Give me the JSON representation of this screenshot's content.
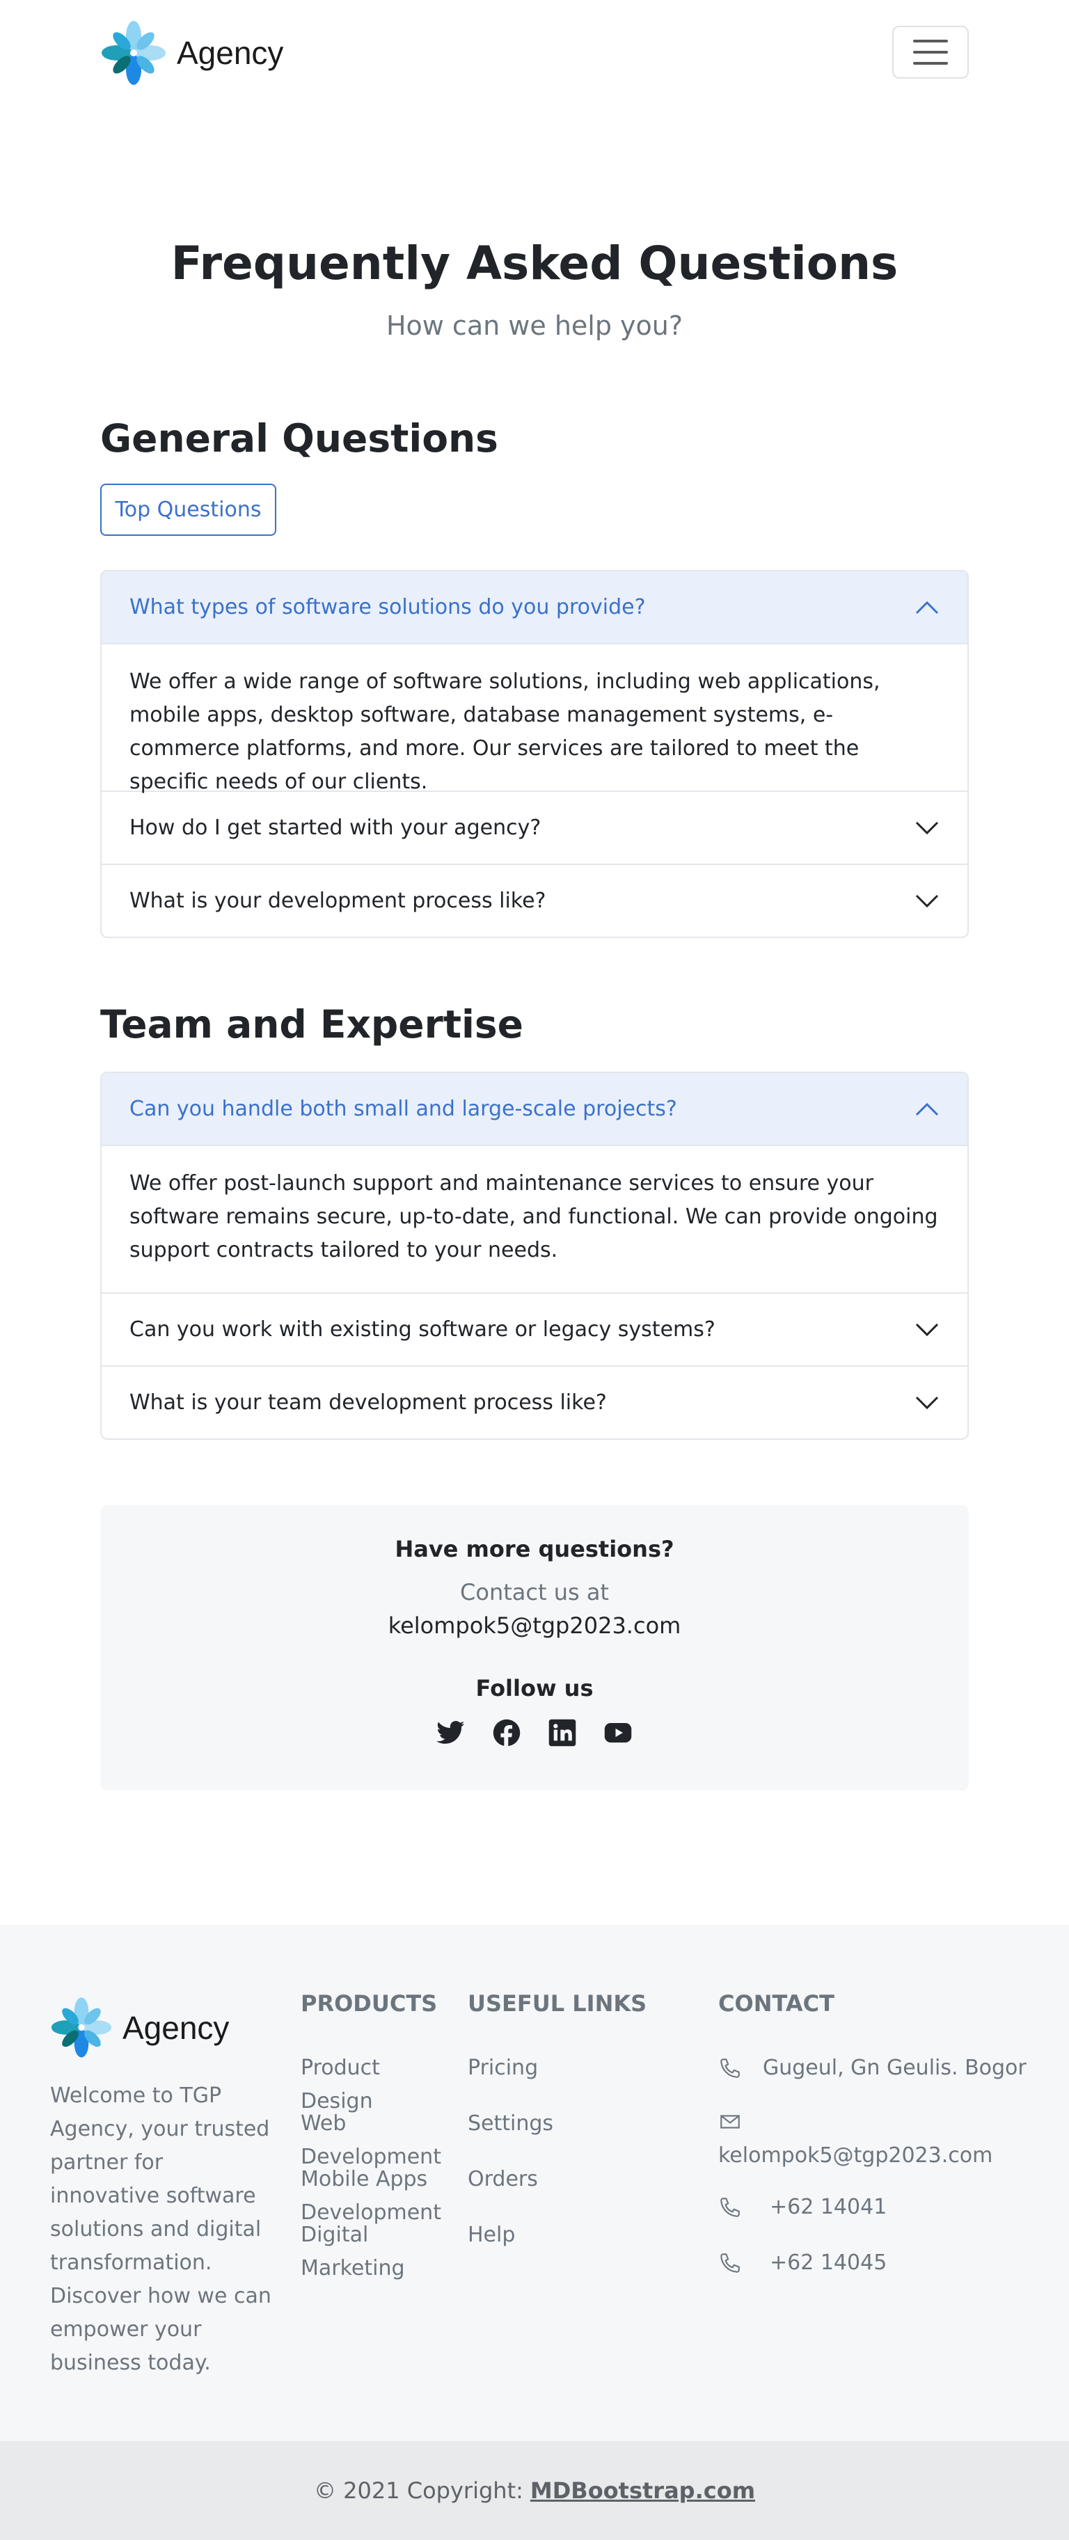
{
  "brand": {
    "name": "Agency",
    "logo_icon": "flower-logo-icon"
  },
  "navbar": {
    "toggler_icon": "hamburger-icon"
  },
  "hero": {
    "title": "Frequently Asked Questions",
    "subtitle": "How can we help you?"
  },
  "general": {
    "title": "General Questions",
    "top_button": "Top Questions",
    "items": [
      {
        "question": "What types of software solutions do you provide?",
        "open": true,
        "answer": "We offer a wide range of software solutions, including web applications, mobile apps, desktop software, database management systems, e-commerce platforms, and more. Our services are tailored to meet the specific needs of our clients."
      },
      {
        "question": "How do I get started with your agency?",
        "open": false
      },
      {
        "question": "What is your development process like?",
        "open": false
      }
    ]
  },
  "team": {
    "title": "Team and Expertise",
    "items": [
      {
        "question": "Can you handle both small and large-scale projects?",
        "open": true,
        "answer": "We offer post-launch support and maintenance services to ensure your software remains secure, up-to-date, and functional. We can provide ongoing support contracts tailored to your needs."
      },
      {
        "question": "Can you work with existing software or legacy systems?",
        "open": false
      },
      {
        "question": "What is your team development process like?",
        "open": false
      }
    ]
  },
  "contact_box": {
    "title": "Have more questions?",
    "sub": "Contact us at",
    "email": "kelompok5@tgp2023.com",
    "follow": "Follow us",
    "social": [
      "twitter-icon",
      "facebook-icon",
      "linkedin-icon",
      "youtube-icon"
    ]
  },
  "footer": {
    "brand_name": "Agency",
    "description": "Welcome to TGP Agency, your trusted partner for innovative software solutions and digital transformation. Discover how we can empower your business today.",
    "products": {
      "title": "PRODUCTS",
      "links": [
        "Product Design",
        "Web Development",
        "Mobile Apps Development",
        "Digital Marketing"
      ]
    },
    "useful": {
      "title": "USEFUL LINKS",
      "links": [
        "Pricing",
        "Settings",
        "Orders",
        "Help"
      ]
    },
    "contact": {
      "title": "CONTACT",
      "address": "Gugeul, Gn Geulis. Bogor",
      "email": "kelompok5@tgp2023.com",
      "phone1": "+62 14041",
      "phone2": "+62 14045"
    }
  },
  "copyright": {
    "text": "© 2021 Copyright:",
    "link": "MDBootstrap.com"
  },
  "colors": {
    "primary": "#3b71ca",
    "accordion_open_bg": "#e9f0fb",
    "muted": "#6c757d",
    "footer_bg": "#f6f7f9"
  }
}
